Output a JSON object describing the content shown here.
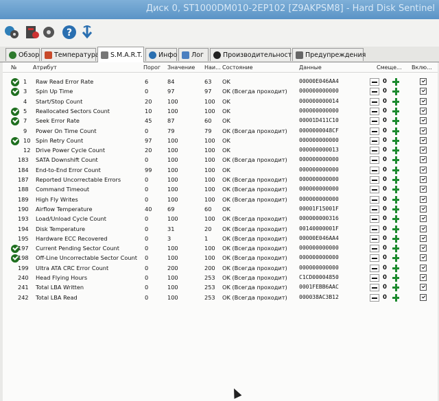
{
  "window": {
    "title": "Диск 0, ST1000DM010-2EP102 [Z9AKPSM8] - Hard Disk Sentinel"
  },
  "toolbar": {
    "icons": [
      "disk-health-icon",
      "report-icon",
      "settings-icon",
      "help-icon",
      "update-icon"
    ]
  },
  "tabs": [
    {
      "label": "Обзор",
      "icon": "ok-icon"
    },
    {
      "label": "Температура",
      "icon": "thermometer-icon"
    },
    {
      "label": "S.M.A.R.T.",
      "icon": "smart-icon"
    },
    {
      "label": "Инфо",
      "icon": "info-icon"
    },
    {
      "label": "Лог",
      "icon": "log-icon"
    },
    {
      "label": "Производительность",
      "icon": "performance-icon"
    },
    {
      "label": "Предупреждения",
      "icon": "warnings-icon"
    }
  ],
  "table": {
    "headers": {
      "num": "№",
      "attr": "Атрибут",
      "threshold": "Порог",
      "value": "Значение",
      "worst": "Наи...",
      "status": "Состояние",
      "data": "Данные",
      "offset": "Смеще...",
      "enabled": "Вклю..."
    },
    "rows": [
      {
        "ok": true,
        "num": "1",
        "attr": "Raw Read Error Rate",
        "threshold": "6",
        "value": "84",
        "worst": "63",
        "status": "OK",
        "data": "00000E046AA4",
        "offset": "0",
        "enabled": true
      },
      {
        "ok": true,
        "num": "3",
        "attr": "Spin Up Time",
        "threshold": "0",
        "value": "97",
        "worst": "97",
        "status": "OK (Всегда проходит)",
        "data": "000000000000",
        "offset": "0",
        "enabled": true
      },
      {
        "ok": false,
        "num": "4",
        "attr": "Start/Stop Count",
        "threshold": "20",
        "value": "100",
        "worst": "100",
        "status": "OK",
        "data": "000000000014",
        "offset": "0",
        "enabled": true
      },
      {
        "ok": true,
        "num": "5",
        "attr": "Reallocated Sectors Count",
        "threshold": "10",
        "value": "100",
        "worst": "100",
        "status": "OK",
        "data": "000000000000",
        "offset": "0",
        "enabled": true
      },
      {
        "ok": true,
        "num": "7",
        "attr": "Seek Error Rate",
        "threshold": "45",
        "value": "87",
        "worst": "60",
        "status": "OK",
        "data": "00001D411C10",
        "offset": "0",
        "enabled": true
      },
      {
        "ok": false,
        "num": "9",
        "attr": "Power On Time Count",
        "threshold": "0",
        "value": "79",
        "worst": "79",
        "status": "OK (Всегда проходит)",
        "data": "0000000048CF",
        "offset": "0",
        "enabled": true
      },
      {
        "ok": true,
        "num": "10",
        "attr": "Spin Retry Count",
        "threshold": "97",
        "value": "100",
        "worst": "100",
        "status": "OK",
        "data": "000000000000",
        "offset": "0",
        "enabled": true
      },
      {
        "ok": false,
        "num": "12",
        "attr": "Drive Power Cycle Count",
        "threshold": "20",
        "value": "100",
        "worst": "100",
        "status": "OK",
        "data": "000000000013",
        "offset": "0",
        "enabled": true
      },
      {
        "ok": false,
        "num": "183",
        "attr": "SATA Downshift Count",
        "threshold": "0",
        "value": "100",
        "worst": "100",
        "status": "OK (Всегда проходит)",
        "data": "000000000000",
        "offset": "0",
        "enabled": true
      },
      {
        "ok": false,
        "num": "184",
        "attr": "End-to-End Error Count",
        "threshold": "99",
        "value": "100",
        "worst": "100",
        "status": "OK",
        "data": "000000000000",
        "offset": "0",
        "enabled": true
      },
      {
        "ok": false,
        "num": "187",
        "attr": "Reported Uncorrectable Errors",
        "threshold": "0",
        "value": "100",
        "worst": "100",
        "status": "OK (Всегда проходит)",
        "data": "000000000000",
        "offset": "0",
        "enabled": true
      },
      {
        "ok": false,
        "num": "188",
        "attr": "Command Timeout",
        "threshold": "0",
        "value": "100",
        "worst": "100",
        "status": "OK (Всегда проходит)",
        "data": "000000000000",
        "offset": "0",
        "enabled": true
      },
      {
        "ok": false,
        "num": "189",
        "attr": "High Fly Writes",
        "threshold": "0",
        "value": "100",
        "worst": "100",
        "status": "OK (Всегда проходит)",
        "data": "000000000000",
        "offset": "0",
        "enabled": true
      },
      {
        "ok": false,
        "num": "190",
        "attr": "Airflow Temperature",
        "threshold": "40",
        "value": "69",
        "worst": "60",
        "status": "OK",
        "data": "00001F15001F",
        "offset": "0",
        "enabled": true
      },
      {
        "ok": false,
        "num": "193",
        "attr": "Load/Unload Cycle Count",
        "threshold": "0",
        "value": "100",
        "worst": "100",
        "status": "OK (Всегда проходит)",
        "data": "000000000316",
        "offset": "0",
        "enabled": true
      },
      {
        "ok": false,
        "num": "194",
        "attr": "Disk Temperature",
        "threshold": "0",
        "value": "31",
        "worst": "20",
        "status": "OK (Всегда проходит)",
        "data": "00140000001F",
        "offset": "0",
        "enabled": true
      },
      {
        "ok": false,
        "num": "195",
        "attr": "Hardware ECC Recovered",
        "threshold": "0",
        "value": "3",
        "worst": "1",
        "status": "OK (Всегда проходит)",
        "data": "00000E046AA4",
        "offset": "0",
        "enabled": true
      },
      {
        "ok": true,
        "num": "197",
        "attr": "Current Pending Sector Count",
        "threshold": "0",
        "value": "100",
        "worst": "100",
        "status": "OK (Всегда проходит)",
        "data": "000000000000",
        "offset": "0",
        "enabled": true
      },
      {
        "ok": true,
        "num": "198",
        "attr": "Off-Line Uncorrectable Sector Count",
        "threshold": "0",
        "value": "100",
        "worst": "100",
        "status": "OK (Всегда проходит)",
        "data": "000000000000",
        "offset": "0",
        "enabled": true
      },
      {
        "ok": false,
        "num": "199",
        "attr": "Ultra ATA CRC Error Count",
        "threshold": "0",
        "value": "200",
        "worst": "200",
        "status": "OK (Всегда проходит)",
        "data": "000000000000",
        "offset": "0",
        "enabled": true
      },
      {
        "ok": false,
        "num": "240",
        "attr": "Head Flying Hours",
        "threshold": "0",
        "value": "100",
        "worst": "253",
        "status": "OK (Всегда проходит)",
        "data": "C1CD00004850",
        "offset": "0",
        "enabled": true
      },
      {
        "ok": false,
        "num": "241",
        "attr": "Total LBA Written",
        "threshold": "0",
        "value": "100",
        "worst": "253",
        "status": "OK (Всегда проходит)",
        "data": "0001FEBB6AAC",
        "offset": "0",
        "enabled": true
      },
      {
        "ok": false,
        "num": "242",
        "attr": "Total LBA Read",
        "threshold": "0",
        "value": "100",
        "worst": "253",
        "status": "OK (Всегда проходит)",
        "data": "000038AC3B12",
        "offset": "0",
        "enabled": true
      }
    ]
  }
}
